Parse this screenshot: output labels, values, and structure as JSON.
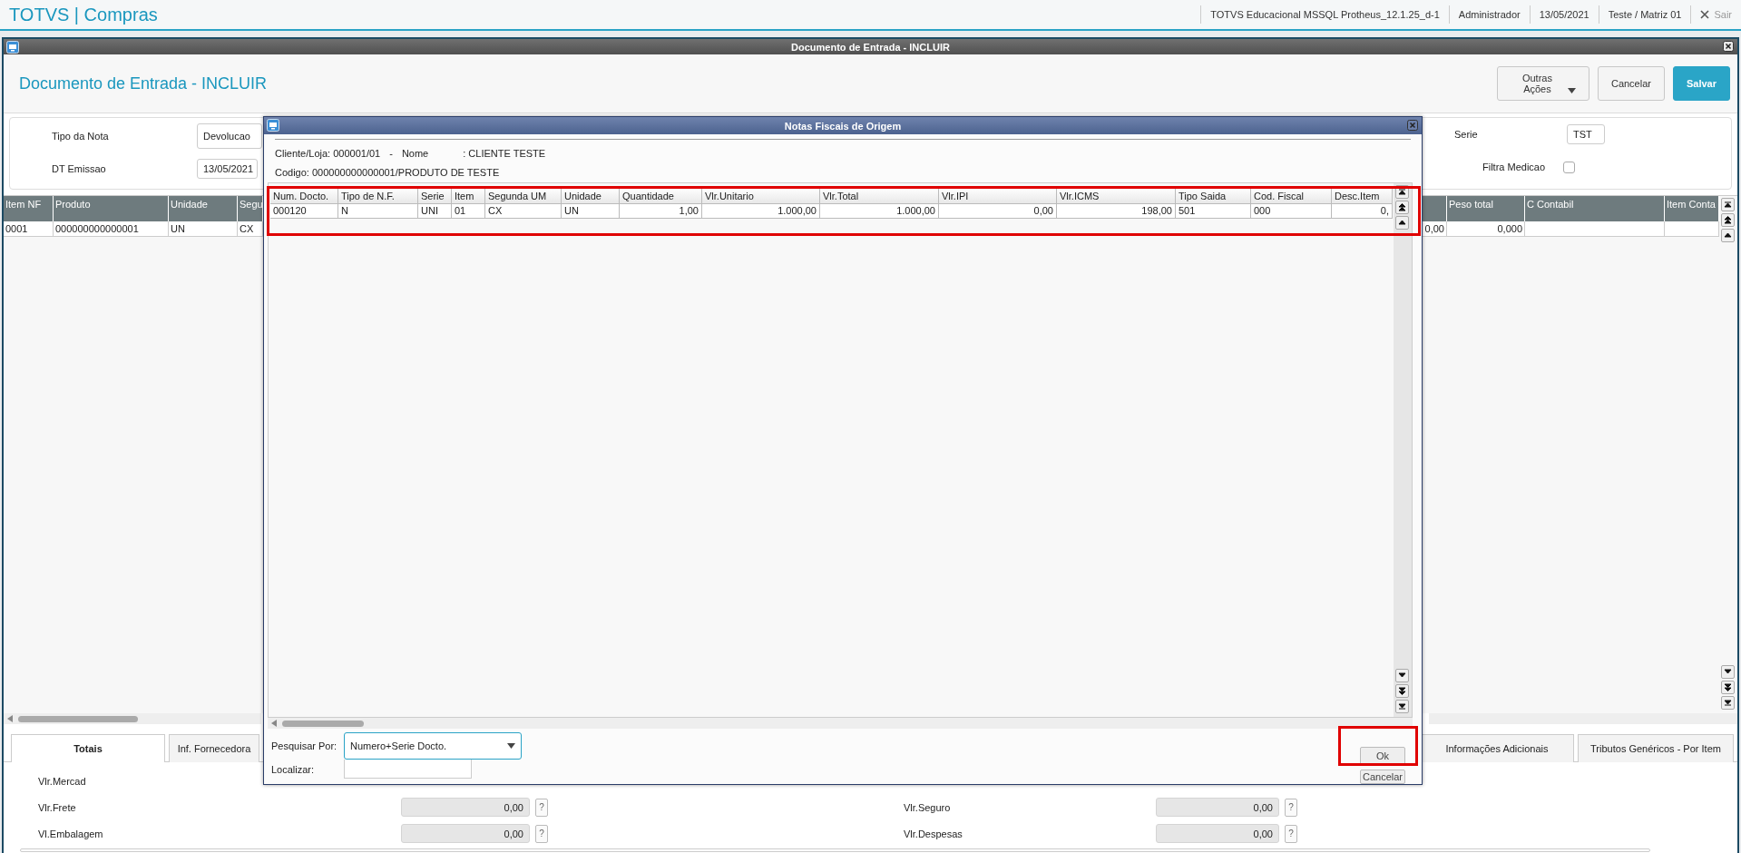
{
  "app_bar": {
    "title": "TOTVS | Compras",
    "items": [
      "TOTVS Educacional MSSQL Protheus_12.1.25_d-1",
      "Administrador",
      "13/05/2021",
      "Teste / Matriz 01"
    ],
    "exit_label": "Sair"
  },
  "window": {
    "title": "Documento de Entrada - INCLUIR",
    "heading": "Documento de Entrada - INCLUIR",
    "buttons": [
      {
        "label": "Outras Ações",
        "kind": "menu"
      },
      {
        "label": "Cancelar",
        "kind": "default"
      },
      {
        "label": "Salvar",
        "kind": "primary"
      }
    ]
  },
  "form": {
    "tipo_label": "Tipo da Nota",
    "tipo_value": "Devolucao",
    "emissao_label": "DT Emissao",
    "emissao_value": "13/05/2021",
    "serie_label": "Serie",
    "serie_value": "TST",
    "filtra_label": "Filtra Medicao",
    "filtra_checked": false
  },
  "items_table": {
    "left_columns": [
      {
        "header": "Item NF",
        "value": "0001"
      },
      {
        "header": "Produto",
        "value": "000000000000001"
      },
      {
        "header": "Unidade",
        "value": "UN"
      },
      {
        "header": "Segu",
        "value": "CX"
      }
    ],
    "right_columns": [
      {
        "value": "0,00"
      },
      {
        "header": "Peso total",
        "value": "0,000"
      },
      {
        "header": "C Contabil"
      },
      {
        "header": "Item Conta"
      }
    ]
  },
  "tabs_left": [
    {
      "label": "Totais",
      "selected": true
    },
    {
      "label": "Inf. Fornecedora",
      "selected": false
    }
  ],
  "tabs_right": [
    {
      "label": "Informações Adicionais",
      "selected": false
    },
    {
      "label": "Tributos Genéricos - Por Item",
      "selected": false
    }
  ],
  "totals": {
    "help_label": "?",
    "left": [
      {
        "label": "Vlr.Mercad"
      },
      {
        "label": "Vlr.Frete",
        "value": "0,00"
      },
      {
        "label": "Vl.Embalagem",
        "value": "0,00"
      }
    ],
    "right": [
      {
        "label": "Vlr.Seguro",
        "value": "0,00"
      },
      {
        "label": "Vlr.Despesas",
        "value": "0,00"
      }
    ]
  },
  "dialog": {
    "title": "Notas Fiscais de Origem",
    "client_fields": [
      "Cliente/Loja: 000001/01",
      "-",
      "Nome",
      ": CLIENTE TESTE"
    ],
    "code_line": "Codigo: 000000000000001/PRODUTO DE TESTE",
    "columns": [
      {
        "label": "Num. Docto.",
        "numeric": false
      },
      {
        "label": "Tipo de N.F.",
        "numeric": false
      },
      {
        "label": "Serie",
        "numeric": false
      },
      {
        "label": "Item",
        "numeric": false
      },
      {
        "label": "Segunda UM",
        "numeric": false
      },
      {
        "label": "Unidade",
        "numeric": false
      },
      {
        "label": "Quantidade",
        "numeric": true
      },
      {
        "label": "Vlr.Unitario",
        "numeric": true
      },
      {
        "label": "Vlr.Total",
        "numeric": true
      },
      {
        "label": "Vlr.IPI",
        "numeric": true
      },
      {
        "label": "Vlr.ICMS",
        "numeric": true
      },
      {
        "label": "Tipo Saida",
        "numeric": false
      },
      {
        "label": "Cod. Fiscal",
        "numeric": false
      },
      {
        "label": "Desc.Item",
        "numeric": true
      }
    ],
    "rows": [
      [
        "000120",
        "N",
        "UNI",
        "01",
        "CX",
        "UN",
        "1,00",
        "1.000,00",
        "1.000,00",
        "0,00",
        "198,00",
        "501",
        "000",
        "0,"
      ]
    ],
    "search_label": "Pesquisar Por:",
    "search_value": "Numero+Serie Docto.",
    "find_label": "Localizar:",
    "ok_label": "Ok",
    "cancel_label": "Cancelar"
  }
}
